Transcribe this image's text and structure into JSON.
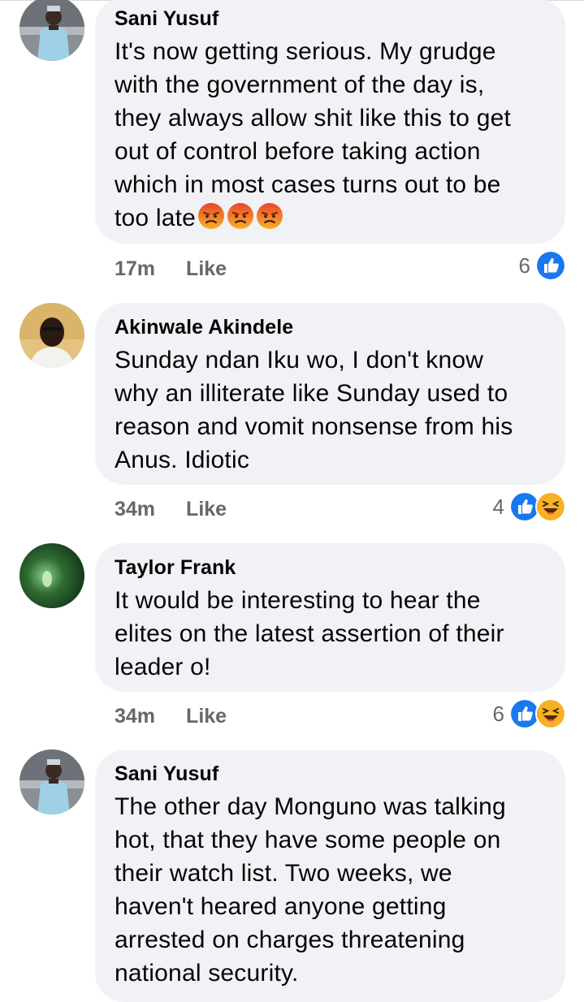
{
  "comments": [
    {
      "author": "Sani Yusuf",
      "text": "It's now getting serious. My grudge\nwith the government of the day is,\nthey always allow shit like this to get\nout of control before taking action\nwhich in most cases turns out to be\ntoo late",
      "text_emojis": [
        "angry-emoji",
        "angry-emoji",
        "angry-emoji"
      ],
      "time": "17m",
      "like_label": "Like",
      "reaction_count": "6",
      "reactions": [
        "like-reaction-icon"
      ]
    },
    {
      "author": "Akinwale Akindele",
      "text": "Sunday ndan Iku wo, I don't know\nwhy an illiterate like Sunday used to\nreason and vomit nonsense from his\nAnus. Idiotic",
      "time": "34m",
      "like_label": "Like",
      "reaction_count": "4",
      "reactions": [
        "like-reaction-icon",
        "haha-reaction-icon"
      ]
    },
    {
      "author": "Taylor Frank",
      "text": "It would be interesting to hear the\nelites on the latest assertion of their\nleader o!",
      "time": "34m",
      "like_label": "Like",
      "reaction_count": "6",
      "reactions": [
        "like-reaction-icon",
        "haha-reaction-icon"
      ]
    },
    {
      "author": "Sani Yusuf",
      "text": "The other day Monguno was talking\nhot, that they have some people on\ntheir watch list. Two weeks, we\nhaven't heared anyone getting\narrested on charges threatening\nnational security."
    }
  ],
  "colors": {
    "bubble": "#f0f2f5",
    "meta_text": "#65676b",
    "like_blue": "#1877f2",
    "haha_yellow": "#f7b125",
    "angry_orange": "#f0652c"
  }
}
